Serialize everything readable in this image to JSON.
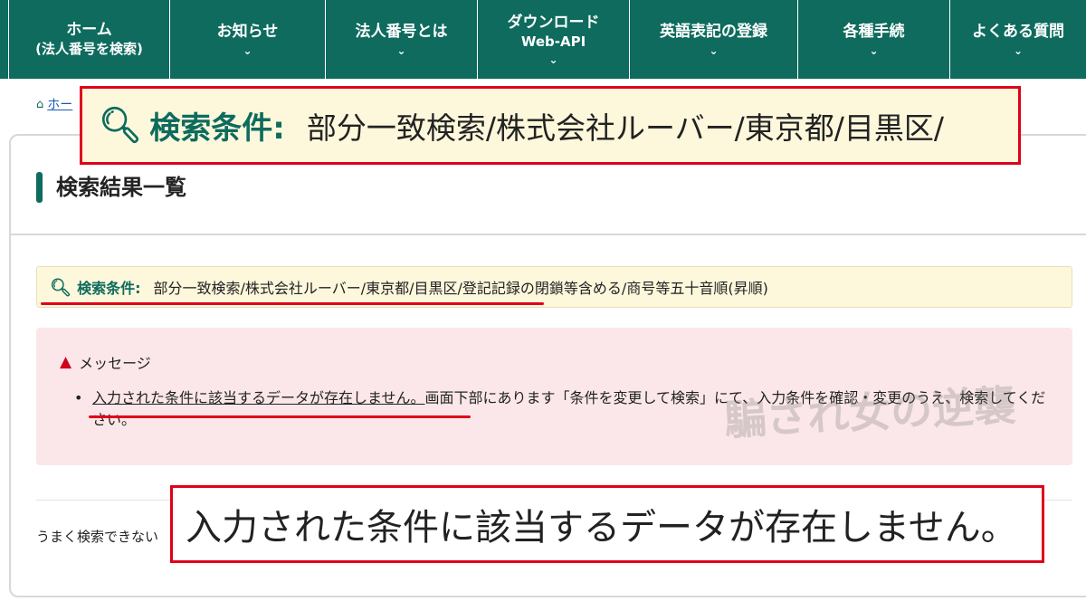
{
  "nav": {
    "items": [
      {
        "label": "ホーム",
        "sub": "(法人番号を検索)",
        "chevron": false
      },
      {
        "label": "お知らせ",
        "sub": "",
        "chevron": true
      },
      {
        "label": "法人番号とは",
        "sub": "",
        "chevron": true
      },
      {
        "label": "ダウンロード",
        "sub": "Web-API",
        "chevron": true
      },
      {
        "label": "英語表記の登録",
        "sub": "",
        "chevron": true
      },
      {
        "label": "各種手続",
        "sub": "",
        "chevron": true
      },
      {
        "label": "よくある質問",
        "sub": "",
        "chevron": true
      }
    ]
  },
  "breadcrumb": {
    "home_label": "ホー"
  },
  "page": {
    "title": "検索結果一覧"
  },
  "search_condition": {
    "label": "検索条件:",
    "value": "部分一致検索/株式会社ルーバー/東京都/目黒区/登記記録の閉鎖等含める/商号等五十音順(昇順)"
  },
  "zoom_condition": {
    "label": "検索条件:",
    "value": "部分一致検索/株式会社ルーバー/東京都/目黒区/"
  },
  "message": {
    "heading": "メッセージ",
    "highlight": "入力された条件に該当するデータが存在しません。",
    "rest": "画面下部にあります「条件を変更して検索」にて、入力条件を確認・変更のうえ、検索してください。"
  },
  "hint": {
    "text": "うまく検索できない"
  },
  "zoom_message": {
    "text": "入力された条件に該当するデータが存在しません。"
  },
  "watermark": {
    "text": "騙され女の逆襲"
  },
  "colors": {
    "nav_bg": "#0e6b5e",
    "highlight_red": "#e0001a",
    "condition_bg": "#fdf8dc",
    "message_bg": "#fbe7e9"
  },
  "icons": {
    "search": "search-icon",
    "warning": "warning-icon",
    "home": "home-icon",
    "chevron": "chevron-down-icon"
  }
}
